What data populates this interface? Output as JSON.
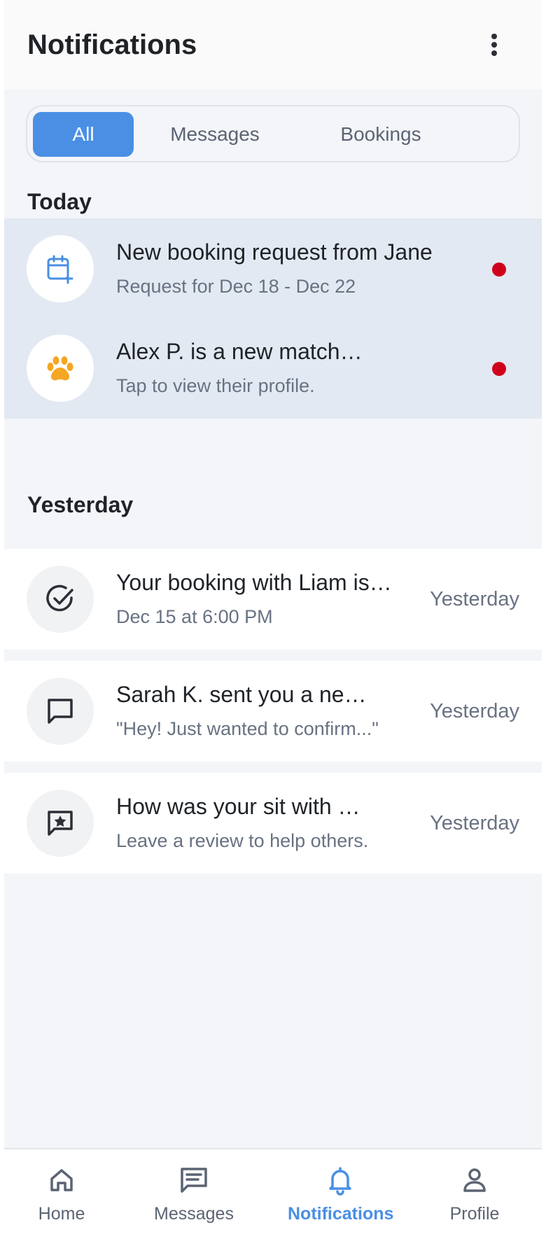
{
  "header": {
    "title": "Notifications"
  },
  "tabs": [
    {
      "label": "All",
      "active": true
    },
    {
      "label": "Messages",
      "active": false
    },
    {
      "label": "Bookings",
      "active": false
    }
  ],
  "sections": {
    "today": "Today",
    "yesterday": "Yesterday"
  },
  "today": [
    {
      "title": "New booking request from Jane",
      "subtitle": "Request for Dec 18 - Dec 22",
      "icon": "calendar-plus-icon",
      "unread": true
    },
    {
      "title": "Alex P. is a new match for your pet",
      "subtitle": "Tap to view their profile.",
      "icon": "paw-icon",
      "unread": true
    }
  ],
  "yesterday": [
    {
      "title": "Your booking with Liam is confirmed",
      "subtitle": "Dec 15 at 6:00 PM",
      "time": "Yesterday",
      "icon": "check-circle-icon"
    },
    {
      "title": "Sarah K. sent you a new message",
      "subtitle": "\"Hey! Just wanted to confirm...\"",
      "time": "Yesterday",
      "icon": "chat-icon"
    },
    {
      "title": "How was your sit with Max?",
      "subtitle": "Leave a review to help others.",
      "time": "Yesterday",
      "icon": "review-star-icon"
    }
  ],
  "nav": [
    {
      "label": "Home",
      "icon": "home-icon",
      "active": false
    },
    {
      "label": "Messages",
      "icon": "messages-icon",
      "active": false
    },
    {
      "label": "Notifications",
      "icon": "bell-icon",
      "active": true
    },
    {
      "label": "Profile",
      "icon": "profile-icon",
      "active": false
    }
  ],
  "colors": {
    "accent": "#4a8fe4",
    "unread_dot": "#d0021b",
    "paw": "#f5a623",
    "unread_bg": "#e3e9f2"
  }
}
